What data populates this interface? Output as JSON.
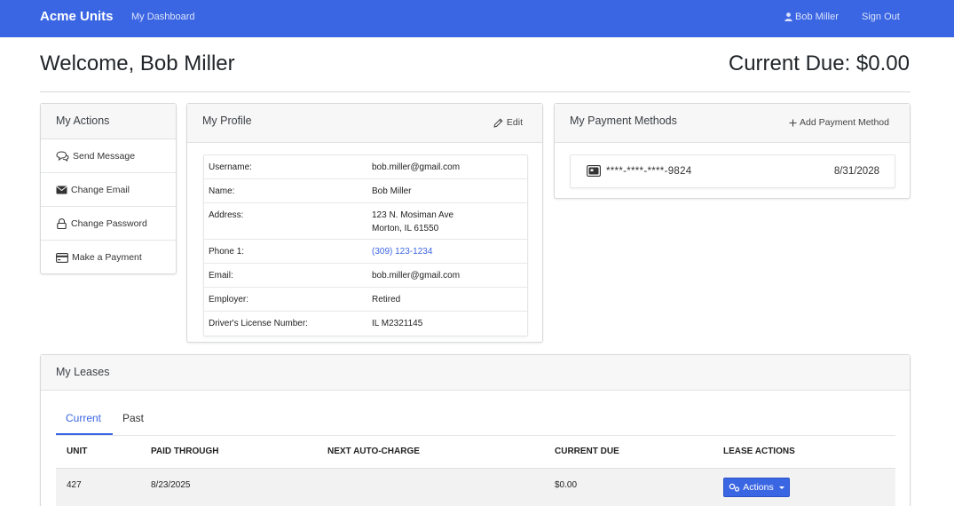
{
  "navbar": {
    "brand": "Acme Units",
    "dashboard_link": "My Dashboard",
    "user_name": "Bob Miller",
    "sign_out": "Sign Out",
    "color": "#3b66e3"
  },
  "header": {
    "welcome": "Welcome, Bob Miller",
    "current_due": "Current Due: $0.00"
  },
  "actions": {
    "title": "My Actions",
    "items": [
      {
        "label": "Send Message",
        "icon": "chat-icon"
      },
      {
        "label": "Change Email",
        "icon": "envelope-icon"
      },
      {
        "label": "Change Password",
        "icon": "lock-icon"
      },
      {
        "label": "Make a Payment",
        "icon": "credit-card-icon"
      }
    ]
  },
  "profile": {
    "title": "My Profile",
    "edit_label": "Edit",
    "rows": [
      {
        "label": "Username:",
        "value": "bob.miller@gmail.com"
      },
      {
        "label": "Name:",
        "value": "Bob Miller"
      },
      {
        "label": "Address:",
        "value": "123 N. Mosiman Ave",
        "value2": "Morton, IL 61550"
      },
      {
        "label": "Phone 1:",
        "value": "(309) 123-1234"
      },
      {
        "label": "Email:",
        "value": "bob.miller@gmail.com"
      },
      {
        "label": "Employer:",
        "value": "Retired"
      },
      {
        "label": "Driver's License Number:",
        "value": "IL M2321145"
      }
    ]
  },
  "payment_methods": {
    "title": "My Payment Methods",
    "add_label": "Add Payment Method",
    "cards": [
      {
        "number": "****-****-****-9824",
        "expiry": "8/31/2028"
      }
    ]
  },
  "leases": {
    "title": "My Leases",
    "tabs": [
      {
        "label": "Current",
        "active": true
      },
      {
        "label": "Past",
        "active": false
      }
    ],
    "columns": [
      "UNIT",
      "PAID THROUGH",
      "NEXT AUTO-CHARGE",
      "CURRENT DUE",
      "LEASE ACTIONS"
    ],
    "rows": [
      {
        "unit": "427",
        "paid_through": "8/23/2025",
        "next_auto_charge": "",
        "current_due": "$0.00",
        "action_label": "Actions"
      }
    ]
  }
}
